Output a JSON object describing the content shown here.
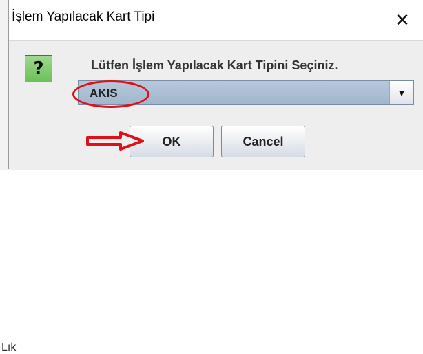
{
  "window": {
    "title": "İşlem Yapılacak Kart Tipi",
    "close_label": "✕"
  },
  "dialog": {
    "icon": "question-icon",
    "icon_glyph": "?",
    "prompt": "Lütfen İşlem Yapılacak Kart Tipini Seçiniz.",
    "combo_value": "AKIS",
    "combo_arrow": "▼",
    "ok_label": "OK",
    "cancel_label": "Cancel"
  },
  "background": {
    "partial_text": "Lık"
  },
  "annotations": {
    "color": "#e0101a"
  }
}
